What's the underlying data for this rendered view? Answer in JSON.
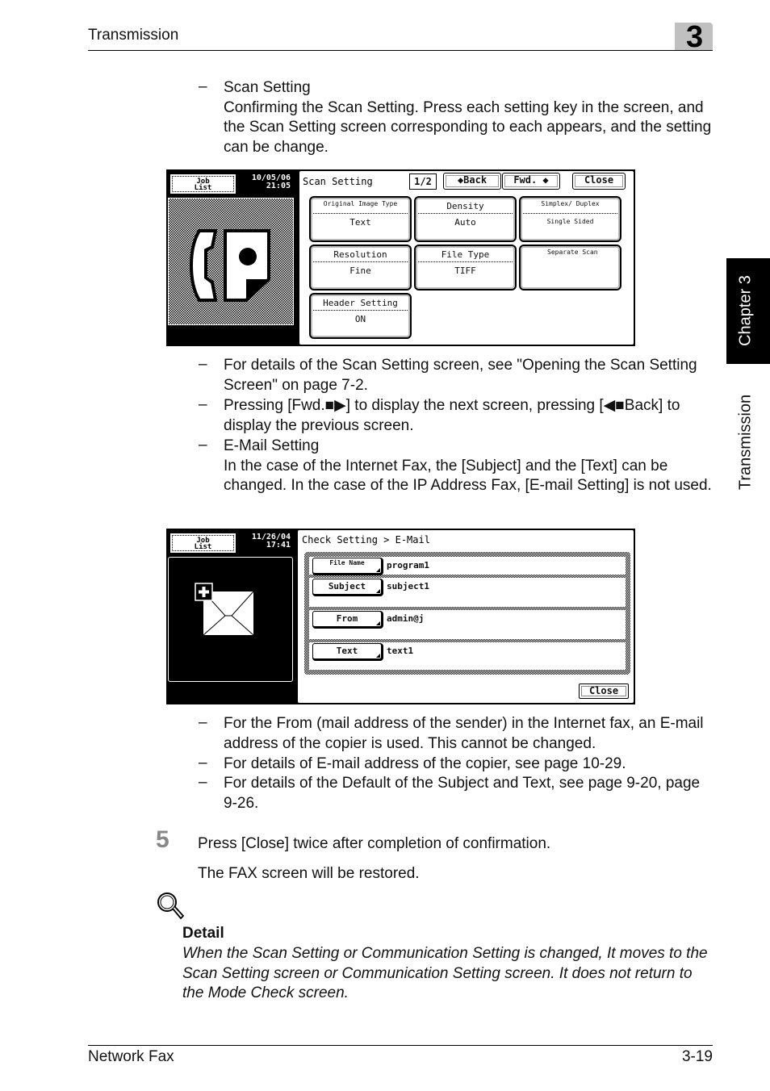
{
  "header": {
    "title": "Transmission",
    "chapter_number": "3"
  },
  "side_tab": {
    "chapter": "Chapter 3",
    "section": "Transmission"
  },
  "scan_setting_intro": {
    "dash": "–",
    "heading": "Scan Setting",
    "body": "Confirming the Scan Setting. Press each setting key in the screen, and the Scan Setting screen corresponding to each appears, and the setting can be change."
  },
  "scan_screen": {
    "job_list": [
      "Job",
      "List"
    ],
    "date": "10/05/06",
    "time": "21:05",
    "title": "Scan Setting",
    "page": "1/2",
    "back_label": "◆Back",
    "fwd_label": "Fwd. ◆",
    "close_label": "Close",
    "keys": [
      {
        "label": "Original Image Type",
        "value": "Text"
      },
      {
        "label": "Density",
        "value": "Auto"
      },
      {
        "label": "Simplex/ Duplex",
        "value": "Single Sided"
      },
      {
        "label": "Resolution",
        "value": "Fine"
      },
      {
        "label": "File Type",
        "value": "TIFF"
      },
      {
        "label": "Separate Scan",
        "value": ""
      },
      {
        "label": "Header Setting",
        "value": "ON"
      }
    ]
  },
  "scan_notes": [
    "For details of the Scan Setting screen, see \"Opening the Scan Setting Screen\" on page 7-2.",
    "Pressing [Fwd.■▶] to display the next screen, pressing [◀■Back] to display the previous screen."
  ],
  "email_intro": {
    "heading": "E-Mail Setting",
    "body": "In the case of the Internet Fax, the [Subject] and the [Text] can be changed. In the case of the IP Address Fax, [E-mail Setting] is not used."
  },
  "email_screen": {
    "job_list": [
      "Job",
      "List"
    ],
    "date": "11/26/04",
    "time": "17:41",
    "title": "Check Setting > E-Mail",
    "rows": [
      {
        "button": "File Name",
        "value": "program1"
      },
      {
        "button": "Subject",
        "value": "subject1"
      },
      {
        "button": "From",
        "value": "admin@j"
      },
      {
        "button": "Text",
        "value": "text1"
      }
    ],
    "close_label": "Close"
  },
  "email_notes": [
    "For the From (mail address of the sender) in the Internet fax, an E-mail address of the copier is used. This cannot be changed.",
    "For details of E-mail address of the copier, see page 10-29.",
    "For details of the Default of the Subject and Text, see page 9-20, page 9-26."
  ],
  "step": {
    "number": "5",
    "instruction": "Press [Close] twice after completion of confirmation.",
    "result": "The FAX screen will be restored."
  },
  "detail": {
    "icon": "magnifier-icon",
    "heading": "Detail",
    "text": "When the Scan Setting or Communication Setting is changed, It moves to the Scan Setting screen or Communication Setting screen. It does not return to the Mode Check screen."
  },
  "footer": {
    "left": "Network Fax",
    "right": "3-19"
  }
}
